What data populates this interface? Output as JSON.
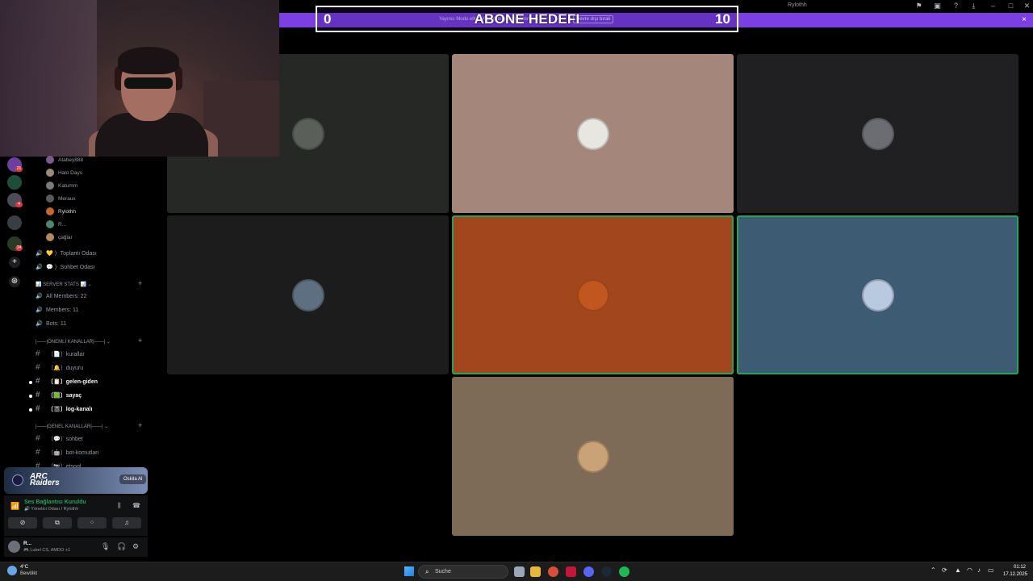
{
  "window": {
    "title": "Rylothh"
  },
  "notice": {
    "text": "Yayıncı Modu etkin. Kişisel bilgilerin gizleniyor.",
    "button_label": "Devre dışı bırak",
    "close": "×"
  },
  "goal": {
    "title": "ABONE HEDEFI",
    "current": "0",
    "target": "10"
  },
  "titlebar_icons": [
    "flag-icon",
    "inbox-icon",
    "help-icon",
    "download-icon",
    "minimize-icon",
    "maximize-icon",
    "close-icon"
  ],
  "servers": [
    {
      "badge": "21"
    },
    {
      "badge": ""
    },
    {
      "badge": "4"
    },
    {
      "badge": ""
    },
    {
      "badge": "34"
    }
  ],
  "sidebar": {
    "members": [
      {
        "name": "Atabey888"
      },
      {
        "name": "Halo Days"
      },
      {
        "name": "Katumm"
      },
      {
        "name": "Meraux"
      },
      {
        "name": "Rylothh"
      },
      {
        "name": "R..."
      },
      {
        "name": "çağlar"
      }
    ],
    "voice_channels": [
      {
        "label": "💛 〉Toplantı Odası"
      },
      {
        "label": "💬 〉Sohbet Odası"
      }
    ],
    "categories": [
      {
        "label": "📊 SERVER STATS 📊 ⌄"
      },
      {
        "label": "|——|ÖNEMLİ KANALLAR|——| ⌄"
      },
      {
        "label": "|——|GENEL KANALLAR|——| ⌄"
      }
    ],
    "stats_channels": [
      {
        "label": "All Members: 22"
      },
      {
        "label": "Members: 11"
      },
      {
        "label": "Bots: 11"
      }
    ],
    "important_channels": [
      {
        "label": "〔📄〕kurallar",
        "unread": false
      },
      {
        "label": "〔🔔〕duyuru",
        "unread": false
      },
      {
        "label": "〔📋〕gelen-giden",
        "unread": true
      },
      {
        "label": "〔🟩〕sayaç",
        "unread": true
      },
      {
        "label": "〔📓〕log-kanalı",
        "unread": true
      }
    ],
    "general_channels": [
      {
        "label": "〔💬〕sohbet"
      },
      {
        "label": "〔🤖〕bot-komutları"
      },
      {
        "label": "〔📷〕etşogl..."
      }
    ]
  },
  "promo": {
    "brand": "ARC Raiders",
    "button": "Oskila Al"
  },
  "voice_panel": {
    "status": "Ses Bağlantısı Kuruldu",
    "channel": "🔊 Yönetici Odası / Rylothh"
  },
  "user_panel": {
    "name": "R...",
    "status": "🎮 Lubel CS, AMDO +1"
  },
  "tiles": [
    {
      "color": "#262826",
      "avatar_color": "#5b5f5a",
      "speaking": false
    },
    {
      "color": "#a4877a",
      "avatar_color": "#e8e6e0",
      "speaking": false
    },
    {
      "color": "#202022",
      "avatar_color": "#6b6d72",
      "speaking": false
    },
    {
      "color": "#1c1c1c",
      "avatar_color": "#5d6f80",
      "speaking": false
    },
    {
      "color": "#a1461d",
      "avatar_color": "#c2561f",
      "speaking": true
    },
    {
      "color": "#3e5b74",
      "avatar_color": "#b8c9e0",
      "speaking": true
    },
    {
      "color": "#7d6b58",
      "avatar_color": "#c9a277",
      "speaking": false
    }
  ],
  "taskbar": {
    "weather_temp": "4°C",
    "weather_cond": "Bewölkt",
    "search_placeholder": "Suche",
    "clock_time": "01:12",
    "clock_date": "17.12.2025"
  },
  "colors": {
    "accent_purple": "#7b3fe4",
    "speaking_green": "#23a55a",
    "unread_white": "#f2f3f5"
  }
}
